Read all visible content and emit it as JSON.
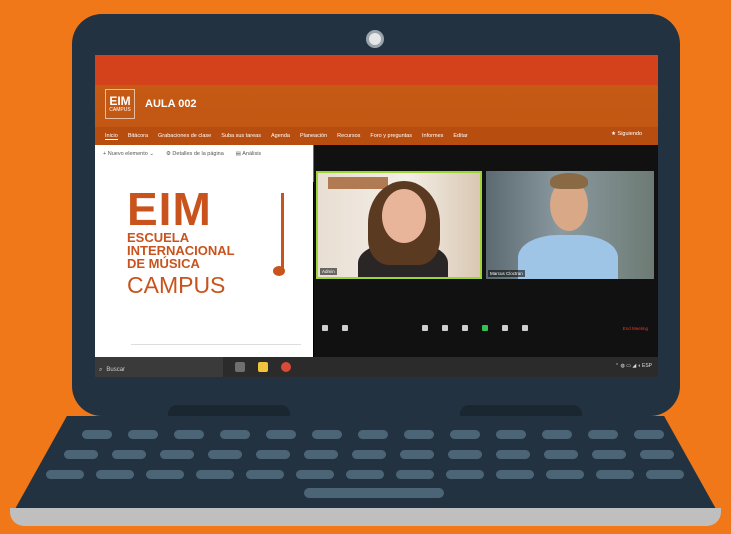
{
  "site": {
    "logo_big": "EIM",
    "logo_small": "CAMPUS",
    "title": "AULA 002"
  },
  "nav": {
    "items": [
      "Inicio",
      "Bitácora",
      "Grabaciones de clase",
      "Suba sus tareas",
      "Agenda",
      "Planeación",
      "Recursos",
      "Foro y preguntas",
      "Informes",
      "Editar"
    ],
    "follow_label": "Siguiendo"
  },
  "commandbar": {
    "new_item": "Nuevo elemento",
    "page_details": "Detalles de la página",
    "analytics": "Análisis"
  },
  "eim_logo": {
    "big": "EIM",
    "line1": "ESCUELA",
    "line2": "INTERNACIONAL",
    "line3": "DE MÚSICA",
    "campus": "CAMPUS"
  },
  "zoom": {
    "participant_1": "Admin",
    "participant_2": "Marcus Cloctran",
    "end_label": "End Meeting"
  },
  "taskbar": {
    "search_label": "Buscar",
    "tray_text": "ESP"
  },
  "colors": {
    "background": "#f07818",
    "laptop_body": "#233240",
    "brand_orange": "#c9531d",
    "active_speaker": "#9fd33a"
  }
}
